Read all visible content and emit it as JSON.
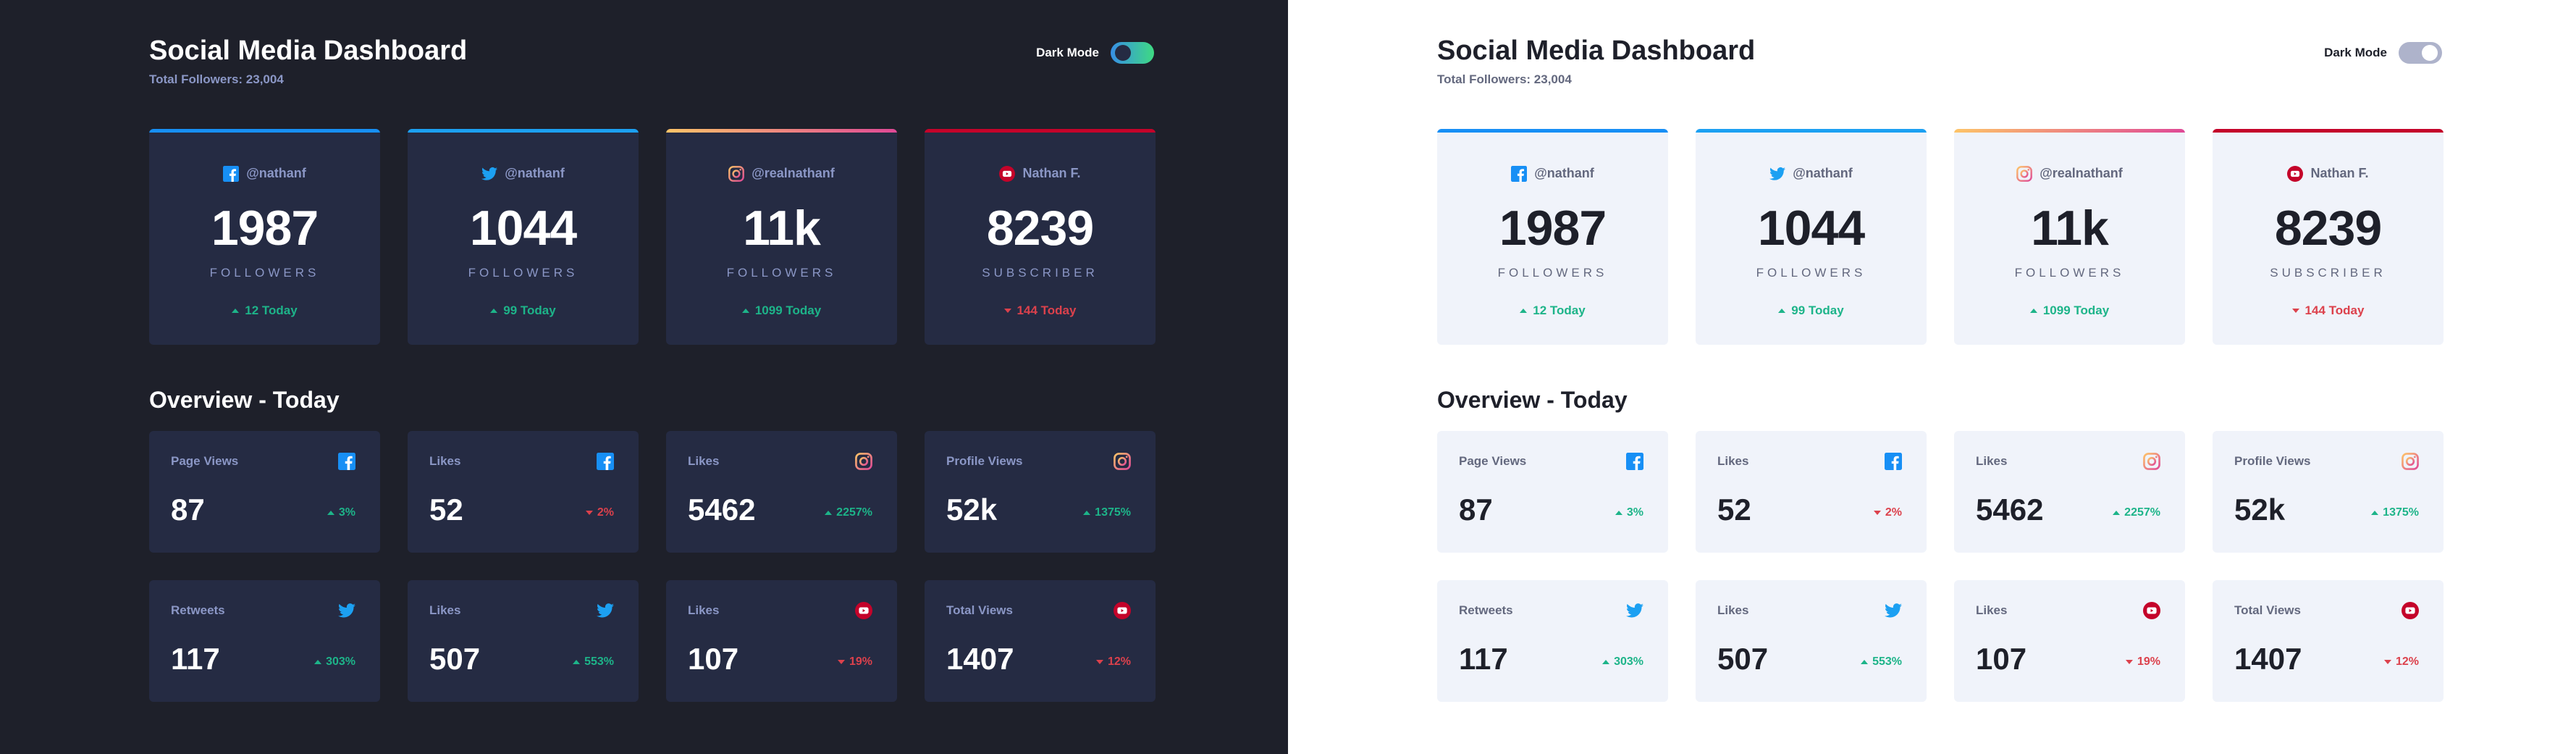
{
  "dashboard": {
    "title": "Social Media Dashboard",
    "total_followers": "Total Followers: 23,004",
    "toggle_label": "Dark Mode",
    "overview_title": "Overview - Today"
  },
  "colors": {
    "facebook": "#178ff5",
    "twitter": "#1ca0f2",
    "instagram_start": "#fdc468",
    "instagram_end": "#df4996",
    "youtube": "#c4032a",
    "up": "#1db489",
    "down": "#dc414c"
  },
  "cards": [
    {
      "platform": "facebook",
      "icon": "facebook-icon",
      "handle": "@nathanf",
      "count": "1987",
      "label": "FOLLOWERS",
      "today": "12 Today",
      "trend": "up"
    },
    {
      "platform": "twitter",
      "icon": "twitter-icon",
      "handle": "@nathanf",
      "count": "1044",
      "label": "FOLLOWERS",
      "today": "99 Today",
      "trend": "up"
    },
    {
      "platform": "instagram",
      "icon": "instagram-icon",
      "handle": "@realnathanf",
      "count": "11k",
      "label": "FOLLOWERS",
      "today": "1099 Today",
      "trend": "up"
    },
    {
      "platform": "youtube",
      "icon": "youtube-icon",
      "handle": "Nathan F.",
      "count": "8239",
      "label": "SUBSCRIBER",
      "today": "144 Today",
      "trend": "down"
    }
  ],
  "overview": [
    {
      "label": "Page Views",
      "icon": "facebook-icon",
      "value": "87",
      "pct": "3%",
      "trend": "up"
    },
    {
      "label": "Likes",
      "icon": "facebook-icon",
      "value": "52",
      "pct": "2%",
      "trend": "down"
    },
    {
      "label": "Likes",
      "icon": "instagram-icon",
      "value": "5462",
      "pct": "2257%",
      "trend": "up"
    },
    {
      "label": "Profile Views",
      "icon": "instagram-icon",
      "value": "52k",
      "pct": "1375%",
      "trend": "up"
    },
    {
      "label": "Retweets",
      "icon": "twitter-icon",
      "value": "117",
      "pct": "303%",
      "trend": "up"
    },
    {
      "label": "Likes",
      "icon": "twitter-icon",
      "value": "507",
      "pct": "553%",
      "trend": "up"
    },
    {
      "label": "Likes",
      "icon": "youtube-icon",
      "value": "107",
      "pct": "19%",
      "trend": "down"
    },
    {
      "label": "Total Views",
      "icon": "youtube-icon",
      "value": "1407",
      "pct": "12%",
      "trend": "down"
    }
  ]
}
